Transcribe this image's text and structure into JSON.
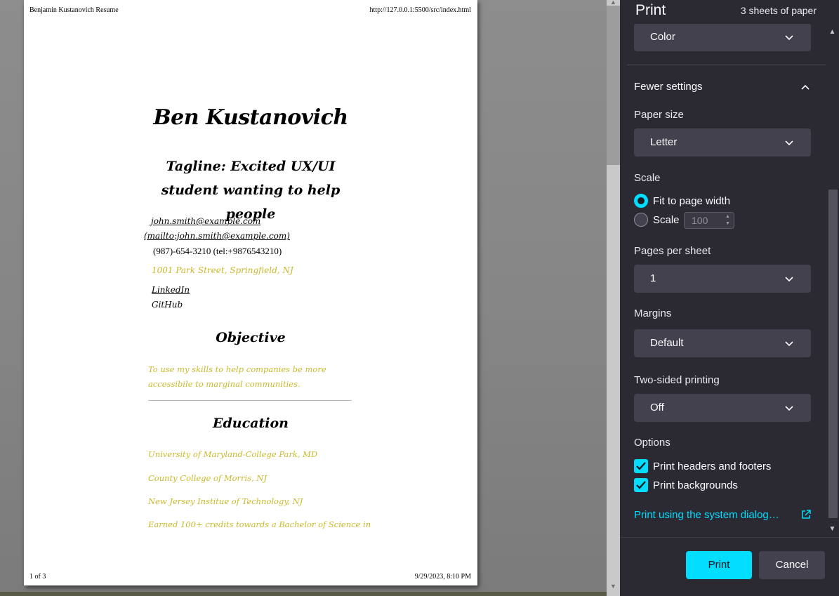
{
  "preview": {
    "header_left": "Benjamin Kustanovich Resume",
    "header_right": "http://127.0.0.1:5500/src/index.html",
    "footer_left": "1 of 3",
    "footer_right": "9/29/2023, 8:10 PM",
    "resume": {
      "name": "Ben Kustanovich",
      "tagline": "Tagline: Excited UX/UI student wanting to help people",
      "email": "john.smith@example.com",
      "mailto": "(mailto:john.smith@example.com)",
      "phone": "(987)-654-3210 (tel:+9876543210)",
      "address": "1001 Park Street, Springfield, NJ",
      "linkedin": "LinkedIn",
      "github": "GitHub",
      "objective_title": "Objective",
      "objective_text": "To use my skills to help companies be more accessibile to marginal communities.",
      "education_title": "Education",
      "education": [
        "University of Maryland-College Park, MD",
        "County College of Morris, NJ",
        "New Jersey Institue of Technology, NJ",
        "Earned 100+ credits towards a Bachelor of Science in"
      ]
    }
  },
  "panel": {
    "title": "Print",
    "sheets": "3 sheets of paper",
    "color_value": "Color",
    "fewer_settings": "Fewer settings",
    "paper_size_label": "Paper size",
    "paper_size_value": "Letter",
    "scale_label": "Scale",
    "fit_label": "Fit to page width",
    "scale_option_label": "Scale",
    "scale_value": "100",
    "pages_per_sheet_label": "Pages per sheet",
    "pages_per_sheet_value": "1",
    "margins_label": "Margins",
    "margins_value": "Default",
    "two_sided_label": "Two-sided printing",
    "two_sided_value": "Off",
    "options_label": "Options",
    "opt_headers": "Print headers and footers",
    "opt_backgrounds": "Print backgrounds",
    "system_dialog": "Print using the system dialog…",
    "print_button": "Print",
    "cancel_button": "Cancel"
  },
  "colors": {
    "accent": "#00ddff",
    "panel_bg": "#2b2a33",
    "control_bg": "#42414d",
    "resume_gold": "#c9b92a"
  },
  "icons": [
    "chevron-down-icon",
    "chevron-up-icon",
    "checkmark-icon",
    "external-link-icon"
  ]
}
